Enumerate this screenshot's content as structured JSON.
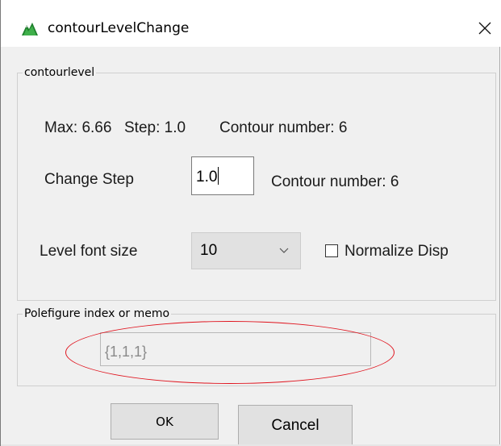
{
  "window": {
    "title": "contourLevelChange",
    "close_glyph": "✕",
    "app_icon": "green-mountain-icon"
  },
  "contour_group": {
    "legend": "contourlevel",
    "info": {
      "max": "Max: 6.66",
      "step": "Step: 1.0",
      "contour_number": "Contour number: 6"
    },
    "change_step": {
      "label": "Change Step",
      "value": "1.0",
      "contour_number": "Contour number: 6"
    },
    "font_size": {
      "label": "Level font size",
      "selected": "10"
    },
    "normalize": {
      "label": "Normalize Disp",
      "checked": false
    }
  },
  "memo_group": {
    "legend": "Polefigure index or memo",
    "value": "{1,1,1}"
  },
  "buttons": {
    "ok": "OK",
    "cancel": "Cancel"
  },
  "colors": {
    "highlight": "#e0141e",
    "dialog_bg": "#f0f0f0"
  }
}
